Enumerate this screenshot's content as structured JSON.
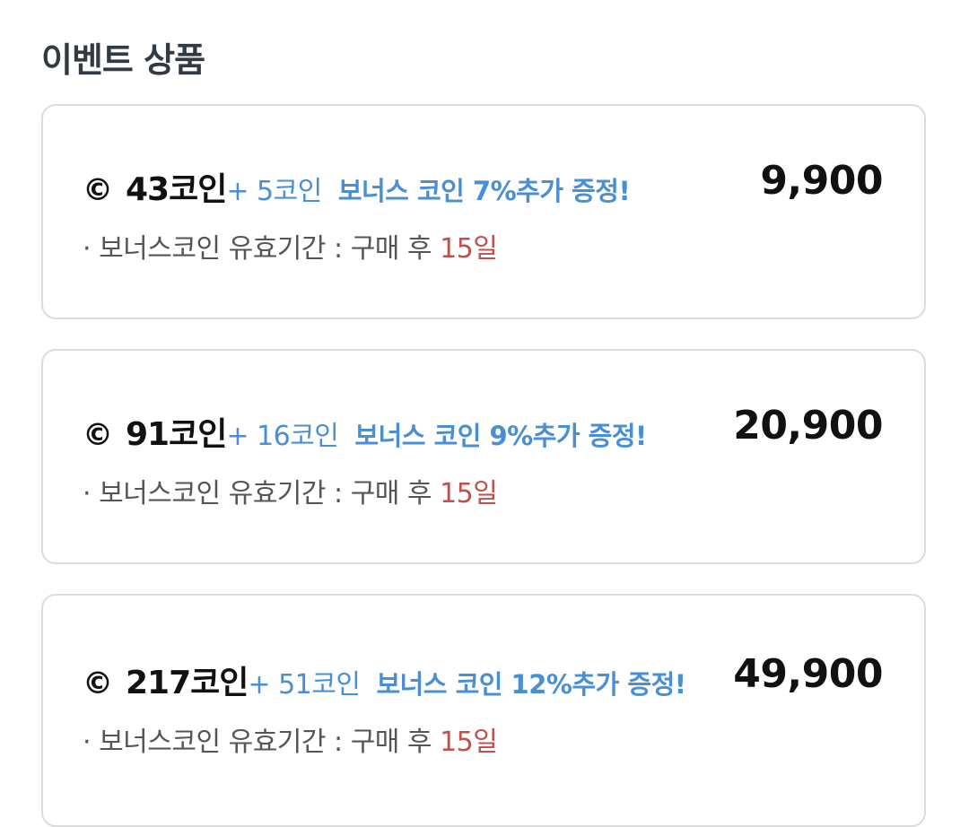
{
  "section": {
    "title": "이벤트 상품"
  },
  "products": [
    {
      "coin_icon": "©",
      "coins": "43코인",
      "bonus": "+ 5코인",
      "promo": "보너스 코인 7%추가 증정!",
      "price": "9,900",
      "validity_label": "· 보너스코인 유효기간 : 구매 후",
      "validity_days": "15일"
    },
    {
      "coin_icon": "©",
      "coins": "91코인",
      "bonus": "+ 16코인",
      "promo": "보너스 코인 9%추가 증정!",
      "price": "20,900",
      "validity_label": "· 보너스코인 유효기간 : 구매 후",
      "validity_days": "15일"
    },
    {
      "coin_icon": "©",
      "coins": "217코인",
      "bonus": "+ 51코인",
      "promo": "보너스 코인 12%추가 증정!",
      "price": "49,900",
      "validity_label": "· 보너스코인 유효기간 : 구매 후",
      "validity_days": "15일"
    }
  ],
  "colors": {
    "accent_blue": "#4a8fd4",
    "highlight_red": "#c0504d",
    "title": "#333a45",
    "border": "#dcdcdc"
  }
}
